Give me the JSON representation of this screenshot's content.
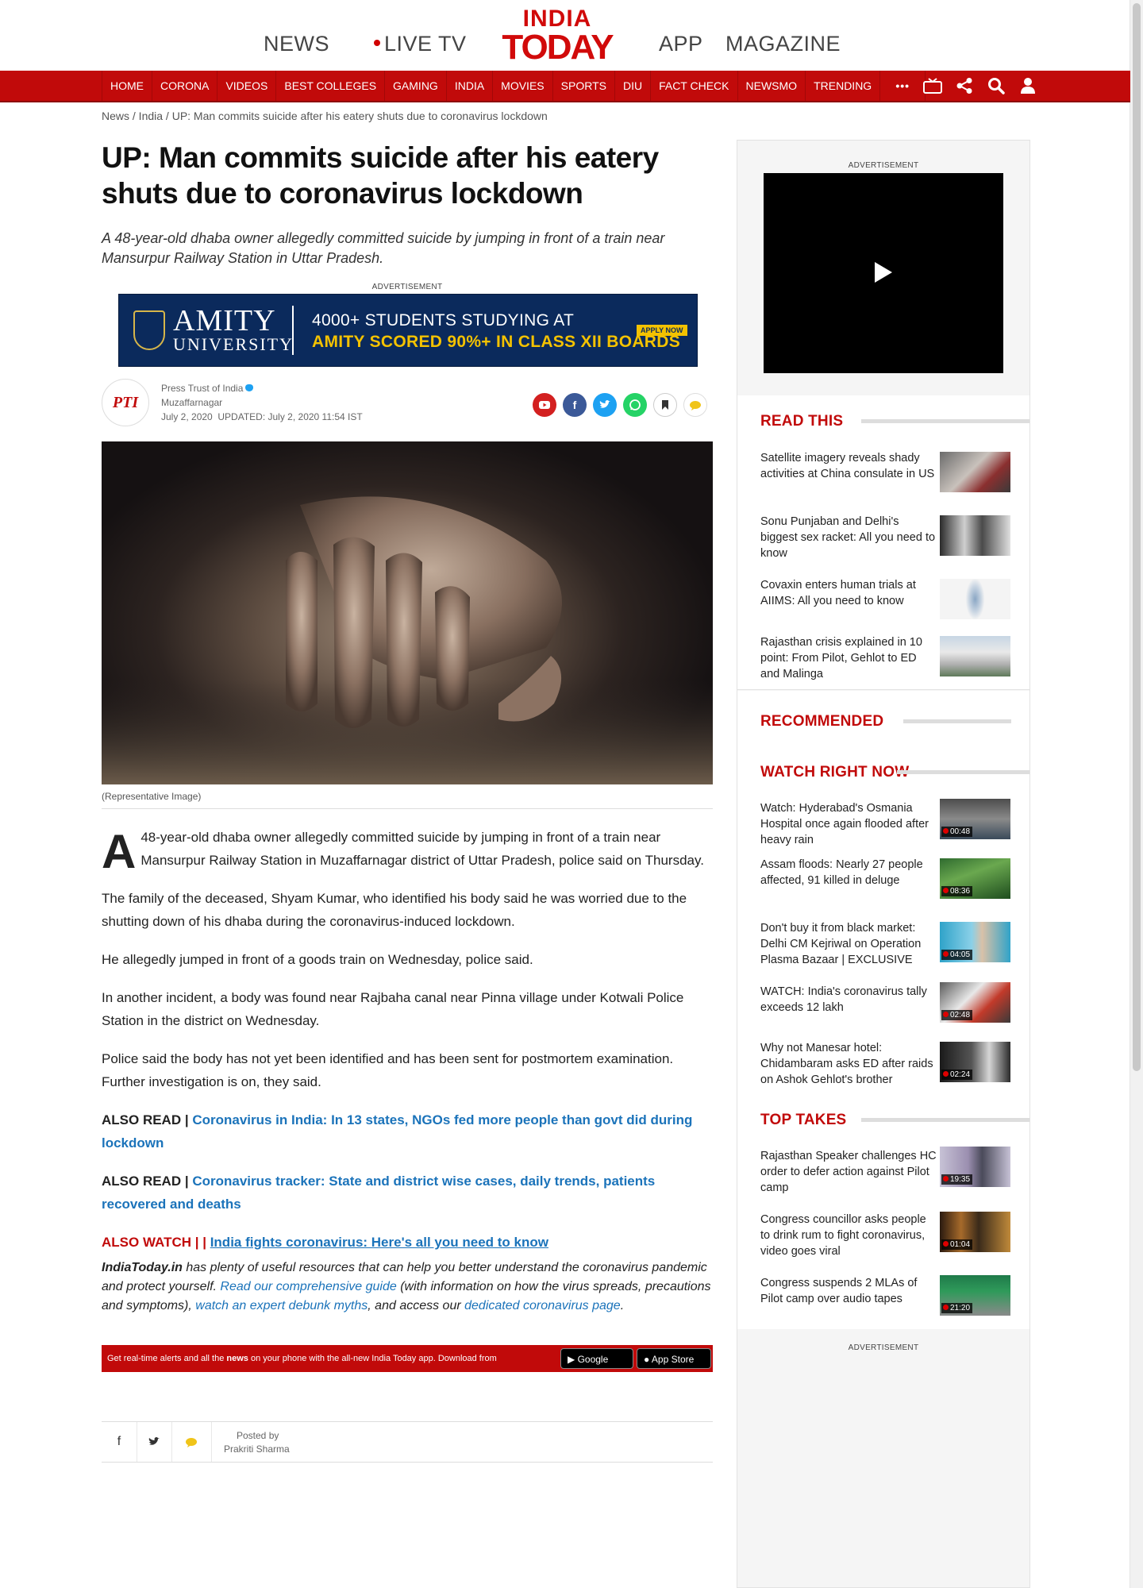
{
  "header": {
    "links": [
      "NEWS",
      "LIVE TV",
      "APP",
      "MAGAZINE"
    ],
    "logo_line1": "INDIA",
    "logo_line2": "TODAY"
  },
  "nav": {
    "items": [
      "HOME",
      "CORONA",
      "VIDEOS",
      "BEST COLLEGES",
      "GAMING",
      "INDIA",
      "MOVIES",
      "SPORTS",
      "DIU",
      "FACT CHECK",
      "NEWSMO",
      "TRENDING"
    ],
    "more": "•••",
    "icons": [
      "tv-icon",
      "share-icon",
      "search-icon",
      "user-icon"
    ]
  },
  "breadcrumb": "News / India / UP: Man commits suicide after his eatery shuts due to coronavirus lockdown",
  "article": {
    "title": "UP: Man commits suicide after his eatery shuts due to coronavirus lockdown",
    "summary": "A 48-year-old dhaba owner allegedly committed suicide by jumping in front of a train near Mansurpur Railway Station in Uttar Pradesh.",
    "ad_label": "ADVERTISEMENT",
    "banner": {
      "brand_line1": "AMITY",
      "brand_line2": "UNIVERSITY",
      "line1": "4000+ STUDENTS STUDYING AT",
      "line2": "AMITY SCORED 90%+ IN CLASS XII BOARDS",
      "cta": "APPLY NOW"
    },
    "source_logo": "PTI",
    "source": "Press Trust of India",
    "location": "Muzaffarnagar",
    "date": "July 2, 2020",
    "updated": "UPDATED: July 2, 2020 11:54 IST",
    "image_caption": "(Representative Image)",
    "dropcap": "A",
    "para1": "48-year-old dhaba owner allegedly committed suicide by jumping in front of a train near Mansurpur Railway Station in Muzaffarnagar district of Uttar Pradesh, police said on Thursday.",
    "para2": "The family of the deceased, Shyam Kumar, who identified his body said he was worried due to the shutting down of his dhaba during the coronavirus-induced lockdown.",
    "para3": "He allegedly jumped in front of a goods train on Wednesday, police said.",
    "para4": "In another incident, a body was found near Rajbaha canal near Pinna village under Kotwali Police Station in the district on Wednesday.",
    "para5": "Police said the body has not yet been identified and has been sent for postmortem examination. Further investigation is on, they said.",
    "also_read_label": "ALSO READ | ",
    "also_read1": "Coronavirus in India: In 13 states, NGOs fed more people than govt did during lockdown",
    "also_read2": "Coronavirus tracker: State and district wise cases, daily trends, patients recovered and deaths",
    "also_watch_label": "ALSO WATCH | | ",
    "also_watch": "India fights coronavirus: Here's all you need to know",
    "res_brand": "IndiaToday.in",
    "res_t1": " has plenty of useful resources that can help you better understand the coronavirus pandemic and protect yourself. ",
    "res_l1": "Read our comprehensive guide",
    "res_t2": " (with information on how the virus spreads, precautions and symptoms), ",
    "res_l2": "watch an expert debunk myths",
    "res_t3": ", and access our ",
    "res_l3": "dedicated coronavirus page",
    "res_t4": ".",
    "app_pre": "Get real-time alerts and all the ",
    "app_bold": "news",
    "app_post": " on your phone with the all-new India Today app. Download from",
    "google_play": "Google play",
    "app_store": "App Store",
    "posted_by_label": "Posted by",
    "posted_by": "Prakriti Sharma"
  },
  "sidebar": {
    "ad_label": "ADVERTISEMENT",
    "read_this_title": "READ THIS",
    "read_this": [
      {
        "title": "Satellite imagery reveals shady activities at China consulate in US"
      },
      {
        "title": "Sonu Punjaban and Delhi's biggest sex racket: All you need to know"
      },
      {
        "title": "Covaxin enters human trials at AIIMS: All you need to know"
      },
      {
        "title": "Rajasthan crisis explained in 10 point: From Pilot, Gehlot to ED and Malinga"
      }
    ],
    "recommended_title": "RECOMMENDED",
    "watch_title": "WATCH RIGHT NOW",
    "watch": [
      {
        "title": "Watch: Hyderabad's Osmania Hospital once again flooded after heavy rain",
        "duration": "00:48"
      },
      {
        "title": "Assam floods: Nearly 27 people affected, 91 killed in deluge",
        "duration": "08:36"
      },
      {
        "title": "Don't buy it from black market: Delhi CM Kejriwal on Operation Plasma Bazaar | EXCLUSIVE",
        "duration": "04:05"
      },
      {
        "title": "WATCH: India's coronavirus tally exceeds 12 lakh",
        "duration": "02:48"
      },
      {
        "title": "Why not Manesar hotel: Chidambaram asks ED after raids on Ashok Gehlot's brother",
        "duration": "02:24"
      }
    ],
    "top_takes_title": "TOP TAKES",
    "top_takes": [
      {
        "title": "Rajasthan Speaker challenges HC order to defer action against Pilot camp",
        "duration": "19:35"
      },
      {
        "title": "Congress councillor asks people to drink rum to fight coronavirus, video goes viral",
        "duration": "01:04"
      },
      {
        "title": "Congress suspends 2 MLAs of Pilot camp over audio tapes",
        "duration": "21:20"
      }
    ],
    "ad_label2": "ADVERTISEMENT"
  }
}
